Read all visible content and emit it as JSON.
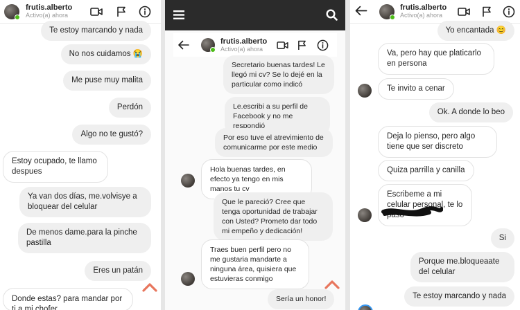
{
  "contact": {
    "name": "frutis.alberto",
    "status": "Activo(a) ahora"
  },
  "panel1": {
    "messages": [
      {
        "text": "Te estoy marcando y nada",
        "dir": "out"
      },
      {
        "text": "No nos cuidamos 😭",
        "dir": "out"
      },
      {
        "text": "Me puse muy malita",
        "dir": "out"
      },
      {
        "text": "Perdón",
        "dir": "out"
      },
      {
        "text": "Algo no te gustó?",
        "dir": "out"
      },
      {
        "text": "Estoy ocupado, te llamo despues",
        "dir": "in"
      },
      {
        "text": "Ya van dos días, me.volvisye a bloquear del celular",
        "dir": "out"
      },
      {
        "text": "De menos dame.para la pinche pastilla",
        "dir": "out"
      },
      {
        "text": "Eres un patán",
        "dir": "out"
      },
      {
        "text": "Donde estas? para mandar por ti a mi chofer",
        "dir": "in"
      }
    ]
  },
  "panel2": {
    "messages": [
      {
        "text": "Secretario buenas tardes! Le llegó mi cv? Se lo dejé en la particular como indicó",
        "dir": "out"
      },
      {
        "text": "Le.escribi a su perfil de Facebook y no me respondió",
        "dir": "out"
      },
      {
        "text": "Por eso tuve el atrevimiento de comunicarme por este medio",
        "dir": "out"
      },
      {
        "text": "Hola buenas tardes, en efecto ya tengo en mis manos tu cv",
        "dir": "in"
      },
      {
        "text": "Que le pareció? Cree que tenga oportunidad de trabajar con Usted? Prometo dar todo mi empeño y dedicación!",
        "dir": "out"
      },
      {
        "text": "Traes buen perfil pero no me gustaria mandarte a ninguna área, quisiera que estuvieras conmigo",
        "dir": "in"
      },
      {
        "text": "Sería un honor!",
        "dir": "out"
      }
    ]
  },
  "panel3": {
    "messages": [
      {
        "text": "Yo encantada 😊",
        "dir": "out"
      },
      {
        "text": "Va, pero hay que platicarlo en persona",
        "dir": "in"
      },
      {
        "text": "Te invito a cenar",
        "dir": "in"
      },
      {
        "text": "Ok. A donde lo beo",
        "dir": "out"
      },
      {
        "text": "Deja lo pienso, pero algo tiene que ser discreto",
        "dir": "in"
      },
      {
        "text": "Quiza parrilla y canilla",
        "dir": "in"
      },
      {
        "text": "Escribeme a mi celular personal, te lo paso",
        "dir": "in"
      },
      {
        "text": "Si",
        "dir": "out"
      },
      {
        "text": "Porque me.bloqueaate del celular",
        "dir": "out"
      },
      {
        "text": "Te estoy marcando y nada",
        "dir": "out"
      }
    ]
  },
  "colors": {
    "online": "#4cbb17",
    "accent": "#e8765d",
    "topbar": "#2b2b2b",
    "bubble_out": "#efefef"
  },
  "icons": [
    "video-camera-icon",
    "flag-icon",
    "info-icon",
    "back-arrow-icon",
    "menu-icon",
    "search-icon",
    "scroll-up-chevron-icon"
  ]
}
